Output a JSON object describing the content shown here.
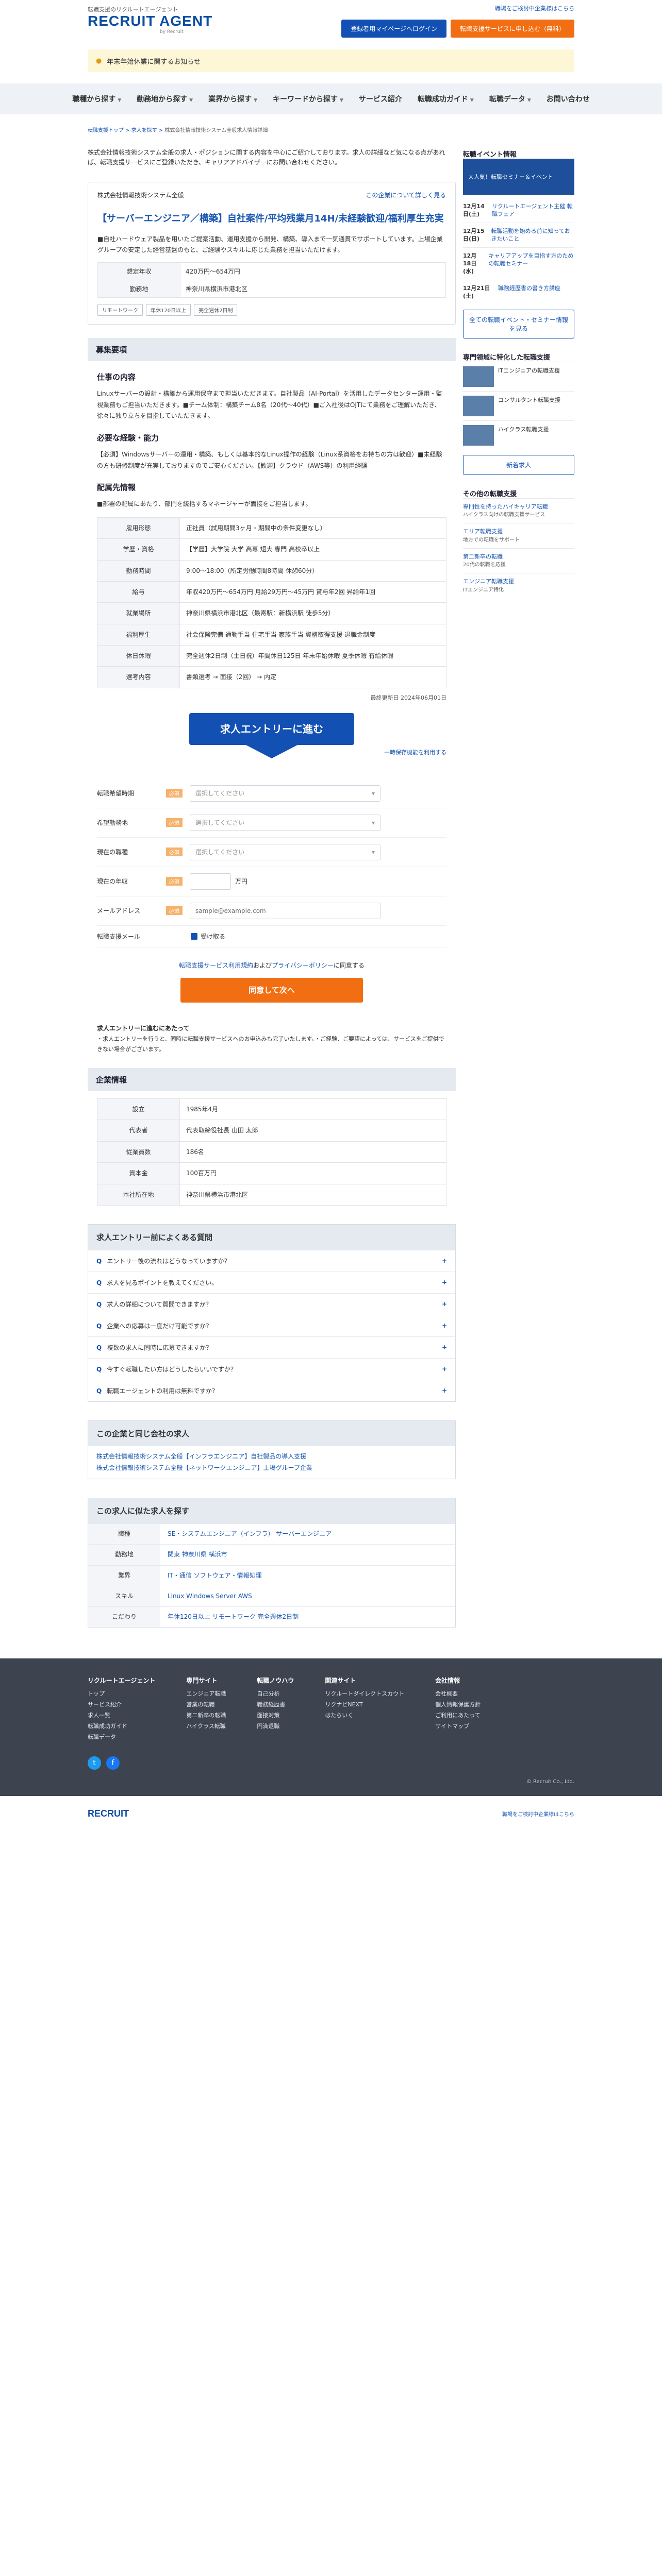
{
  "header": {
    "tagline": "転職支援のリクルートエージェント",
    "logo": "RECRUIT AGENT",
    "logo_sub": "by Recruit",
    "top_link": "職場をご検討中企業様はこちら",
    "btn_login": "登録者用マイページへログイン",
    "btn_register": "転職支援サービスに申し込む（無料）"
  },
  "notice": "年末年始休業に関するお知らせ",
  "gnav": [
    "職種から探す",
    "勤務地から探す",
    "業界から探す",
    "キーワードから探す",
    "サービス紹介",
    "転職成功ガイド",
    "転職データ",
    "お問い合わせ"
  ],
  "breadcrumb": {
    "items": [
      "転職支援トップ",
      "求人を探す"
    ],
    "current": "株式会社情報技術システム全般求人情報詳細"
  },
  "intro": "株式会社情報技術システム全般の求人・ポジションに関する内容を中心にご紹介しております。求人の詳細など気になる点があれば、転職支援サービスにご登録いただき、キャリアアドバイザーにお問い合わせください。",
  "job": {
    "company": "株式会社情報技術システム全般",
    "recent_link": "この企業について詳しく見る",
    "title": "【サーバーエンジニア／構築】自社案件/平均残業月14H/未経験歓迎/福利厚生充実",
    "lead": "■自社ハードウェア製品を用いたご提案活動、運用支援から開発、構築、導入まで一気通貫でサポートしています。上場企業グループの安定した経営基盤のもと、ご経験やスキルに応じた業務を担当いただけます。",
    "summary": [
      {
        "k": "想定年収",
        "v": "420万円〜654万円"
      },
      {
        "k": "勤務地",
        "v": "神奈川県横浜市港北区"
      }
    ],
    "tags": [
      "リモートワーク",
      "年休120日以上",
      "完全週休2日制"
    ]
  },
  "sections": {
    "recruit_head": "募集要項",
    "work_head": "仕事の内容",
    "work_text": "Linuxサーバーの設計・構築から運用保守まで担当いただきます。自社製品（AI-Portal）を活用したデータセンター運用・監視業務もご担当いただきます。■チーム体制：構築チーム8名（20代〜40代）■ご入社後はOJTにて業務をご理解いただき、徐々に独り立ちを目指していただきます。",
    "skill_head": "必要な経験・能力",
    "skill_text": "【必須】Windowsサーバーの運用・構築、もしくは基本的なLinux操作の経験（Linux系資格をお持ちの方は歓迎）■未経験の方も研修制度が充実しておりますのでご安心ください。【歓迎】クラウド（AWS等）の利用経験",
    "detail_head": "配属先情報",
    "detail_lead": "■部署の配属にあたり、部門を統括するマネージャーが面接をご担当します。"
  },
  "details": [
    {
      "k": "雇用形態",
      "v": "正社員（試用期間3ヶ月・期間中の条件変更なし）"
    },
    {
      "k": "学歴・資格",
      "v": "【学歴】大学院 大学 高専 短大 専門 高校卒以上"
    },
    {
      "k": "勤務時間",
      "v": "9:00〜18:00（所定労働時間8時間 休憩60分）"
    },
    {
      "k": "給与",
      "v": "年収420万円〜654万円 月給29万円〜45万円 賞与年2回 昇給年1回"
    },
    {
      "k": "就業場所",
      "v": "神奈川県横浜市港北区（最寄駅：新横浜駅 徒歩5分）"
    },
    {
      "k": "福利厚生",
      "v": "社会保険完備 通勤手当 住宅手当 家族手当 資格取得支援 退職金制度"
    },
    {
      "k": "休日休暇",
      "v": "完全週休2日制（土日祝）年間休日125日 年末年始休暇 夏季休暇 有給休暇"
    },
    {
      "k": "選考内容",
      "v": "書類選考 → 面接（2回） → 内定"
    }
  ],
  "updated": "最終更新日 2024年06月01日",
  "entry": {
    "big": "求人エントリーに進む",
    "link": "一時保存機能を利用する",
    "fields": [
      {
        "label": "転職希望時期",
        "req": "必須",
        "placeholder": "選択してください"
      },
      {
        "label": "希望勤務地",
        "req": "必須",
        "placeholder": "選択してください"
      },
      {
        "label": "現在の職種",
        "req": "必須",
        "placeholder": "選択してください"
      },
      {
        "label": "現在の年収",
        "req": "必須",
        "placeholder": "",
        "unit": "万円"
      },
      {
        "label": "メールアドレス",
        "req": "必須",
        "placeholder": "sample@example.com"
      }
    ],
    "mail_label": "転職支援メール",
    "mail_check": "受け取る",
    "agree_pre": "転職支援サービス利用規約",
    "agree_mid": "および",
    "agree_post": "プライバシーポリシー",
    "agree_tail": "に同意する",
    "next": "同意して次へ"
  },
  "notes_title": "求人エントリーに進むにあたって",
  "notes": "・求人エントリーを行うと、同時に転職支援サービスへのお申込みも完了いたします。・ご経験、ご要望によっては、サービスをご提供できない場合がございます。",
  "company_head": "企業情報",
  "company_rows": [
    {
      "k": "設立",
      "v": "1985年4月"
    },
    {
      "k": "代表者",
      "v": "代表取締役社長 山田 太郎"
    },
    {
      "k": "従業員数",
      "v": "186名"
    },
    {
      "k": "資本金",
      "v": "100百万円"
    },
    {
      "k": "本社所在地",
      "v": "神奈川県横浜市港北区"
    }
  ],
  "faq_head": "求人エントリー前によくある質問",
  "faqs": [
    "エントリー後の流れはどうなっていますか？",
    "求人を見るポイントを教えてください。",
    "求人の詳細について質問できますか？",
    "企業への応募は一度だけ可能ですか？",
    "複数の求人に同時に応募できますか？",
    "今すぐ転職したい方はどうしたらいいですか？",
    "転職エージェントの利用は無料ですか？"
  ],
  "same_head": "この企業と同じ会社の求人",
  "same_links": [
    "株式会社情報技術システム全般【インフラエンジニア】自社製品の導入支援",
    "株式会社情報技術システム全般【ネットワークエンジニア】上場グループ企業"
  ],
  "related_head": "この求人に似た求人を探す",
  "related": [
    {
      "k": "職種",
      "v": "SE・システムエンジニア（インフラ） サーバーエンジニア"
    },
    {
      "k": "勤務地",
      "v": "関東 神奈川県 横浜市"
    },
    {
      "k": "業界",
      "v": "IT・通信 ソフトウェア・情報処理"
    },
    {
      "k": "スキル",
      "v": "Linux Windows Server AWS"
    },
    {
      "k": "こだわり",
      "v": "年休120日以上 リモートワーク 完全週休2日制"
    }
  ],
  "sidebar": {
    "event_head": "転職イベント情報",
    "event_banner": "大人気！転職セミナー＆イベント",
    "events": [
      {
        "d": "12月14日(土)",
        "t": "リクルートエージェント主催 転職フェア"
      },
      {
        "d": "12月15日(日)",
        "t": "転職活動を始める前に知っておきたいこと"
      },
      {
        "d": "12月18日(水)",
        "t": "キャリアアップを目指す方のための転職セミナー"
      },
      {
        "d": "12月21日(土)",
        "t": "職務経歴書の書き方講座"
      }
    ],
    "event_btn": "全ての転職イベント・セミナー情報を見る",
    "feature_head": "専門領域に特化した転職支援",
    "features": [
      "ITエンジニアの転職支援",
      "コンサルタント転職支援",
      "ハイクラス転職支援"
    ],
    "new_btn": "新着求人",
    "other_head": "その他の転職支援",
    "others": [
      {
        "t": "専門性を持ったハイキャリア転職",
        "s": "ハイクラス向けの転職支援サービス"
      },
      {
        "t": "エリア転職支援",
        "s": "地方での転職をサポート"
      },
      {
        "t": "第二新卒の転職",
        "s": "20代の転職を応援"
      },
      {
        "t": "エンジニア転職支援",
        "s": "ITエンジニア特化"
      }
    ]
  },
  "footer": {
    "cols": [
      {
        "title": "リクルートエージェント",
        "items": [
          "トップ",
          "サービス紹介",
          "求人一覧",
          "転職成功ガイド",
          "転職データ"
        ]
      },
      {
        "title": "専門サイト",
        "items": [
          "エンジニア転職",
          "営業の転職",
          "第二新卒の転職",
          "ハイクラス転職"
        ]
      },
      {
        "title": "転職ノウハウ",
        "items": [
          "自己分析",
          "職務経歴書",
          "面接対策",
          "円満退職"
        ]
      },
      {
        "title": "関連サイト",
        "items": [
          "リクルートダイレクトスカウト",
          "リクナビNEXT",
          "はたらいく"
        ]
      },
      {
        "title": "会社情報",
        "items": [
          "会社概要",
          "個人情報保護方針",
          "ご利用にあたって",
          "サイトマップ"
        ]
      }
    ],
    "copyright": "© Recruit Co., Ltd.",
    "bottom_logo": "RECRUIT",
    "bottom_right": "職場をご検討中企業様はこちら"
  }
}
